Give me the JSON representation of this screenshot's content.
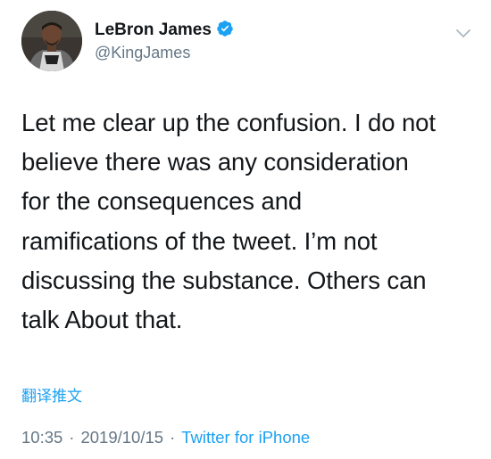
{
  "author": {
    "display_name": "LeBron James",
    "handle": "@KingJames",
    "verified": true,
    "avatar_icon": "profile-photo-avatar"
  },
  "tweet": {
    "lines": [
      "Let me clear up the confusion. I do not",
      "believe there was any consideration",
      "for the consequences and",
      "ramifications of the tweet.  I’m not",
      "discussing the substance.  Others can",
      "talk About that."
    ],
    "translate_label": "翻译推文"
  },
  "meta": {
    "time": "10:35",
    "separator": "·",
    "date": "2019/10/15",
    "source": "Twitter for iPhone"
  },
  "colors": {
    "text": "#14171a",
    "secondary": "#657786",
    "accent": "#1da1f2"
  },
  "icons": {
    "verified": "verified-badge-icon",
    "menu": "chevron-down-icon"
  }
}
